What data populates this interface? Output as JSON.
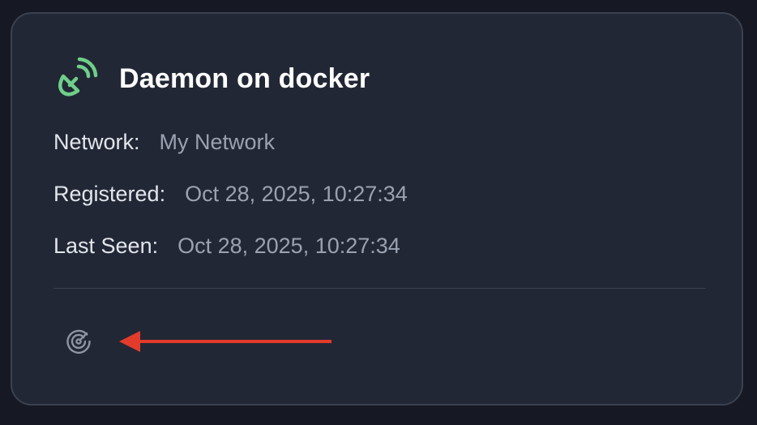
{
  "daemon": {
    "name": "Daemon on docker",
    "icon": "satellite-dish-icon",
    "icon_color": "#6ecf8a"
  },
  "fields": {
    "network_label": "Network:",
    "network_value": "My Network",
    "registered_label": "Registered:",
    "registered_value": "Oct 28, 2025, 10:27:34",
    "last_seen_label": "Last Seen:",
    "last_seen_value": "Oct 28, 2025, 10:27:34"
  },
  "footer": {
    "action_icon": "radar-icon"
  },
  "annotation": {
    "type": "arrow",
    "color": "#e33b2b",
    "points_to": "radar-icon"
  },
  "colors": {
    "background": "#161823",
    "card": "#222735",
    "card_border": "#3b414f"
  }
}
